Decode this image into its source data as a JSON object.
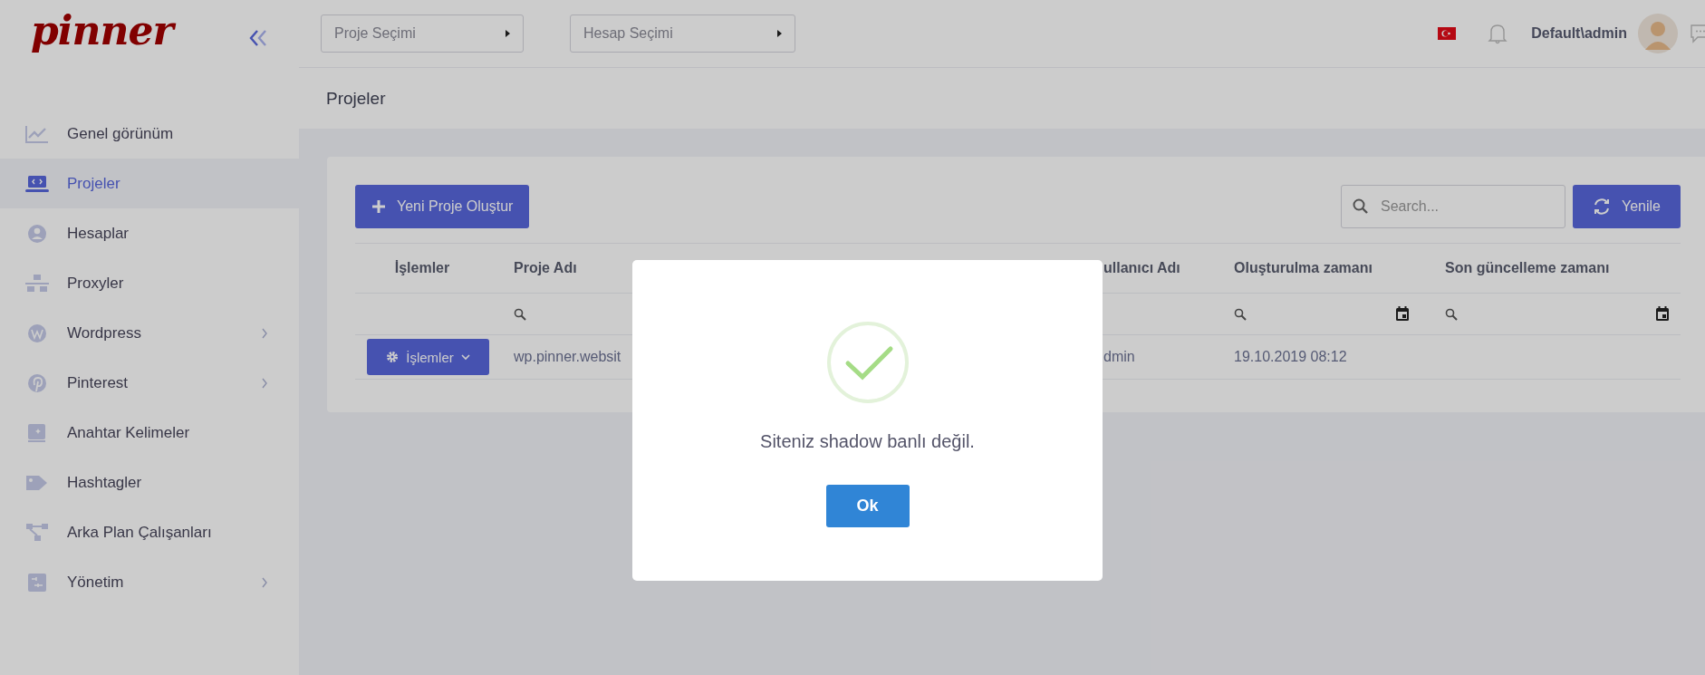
{
  "logo": "pinner",
  "sidebar": {
    "items": [
      {
        "label": "Genel görünüm",
        "selected": false,
        "submenu": false
      },
      {
        "label": "Projeler",
        "selected": true,
        "submenu": false
      },
      {
        "label": "Hesaplar",
        "selected": false,
        "submenu": false
      },
      {
        "label": "Proxyler",
        "selected": false,
        "submenu": false
      },
      {
        "label": "Wordpress",
        "selected": false,
        "submenu": true
      },
      {
        "label": "Pinterest",
        "selected": false,
        "submenu": true
      },
      {
        "label": "Anahtar Kelimeler",
        "selected": false,
        "submenu": false
      },
      {
        "label": "Hashtagler",
        "selected": false,
        "submenu": false
      },
      {
        "label": "Arka Plan Çalışanları",
        "selected": false,
        "submenu": false
      },
      {
        "label": "Yönetim",
        "selected": false,
        "submenu": true
      }
    ]
  },
  "topbar": {
    "project_select": {
      "placeholder": "Proje Seçimi"
    },
    "account_select": {
      "placeholder": "Hesap Seçimi"
    },
    "user": "Default\\admin"
  },
  "page_title": "Projeler",
  "toolbar": {
    "new_button": "Yeni Proje Oluştur",
    "search": {
      "placeholder": "Search..."
    },
    "refresh_button": "Yenile"
  },
  "table": {
    "columns": [
      {
        "label": "İşlemler",
        "kind": "plain"
      },
      {
        "label": "Proje Adı",
        "kind": "text"
      },
      {
        "label": "ullanıcı Adı",
        "kind": "plain"
      },
      {
        "label": "Oluşturulma zamanı",
        "kind": "date"
      },
      {
        "label": "Son güncelleme zamanı",
        "kind": "date"
      }
    ],
    "rows": [
      {
        "action_button": "İşlemler",
        "project_name": "wp.pinner.websit",
        "user_name": "dmin",
        "created": "19.10.2019 08:12"
      }
    ]
  },
  "dialog": {
    "kind": "success",
    "message": "Siteniz shadow banlı değil.",
    "button": "Ok"
  }
}
